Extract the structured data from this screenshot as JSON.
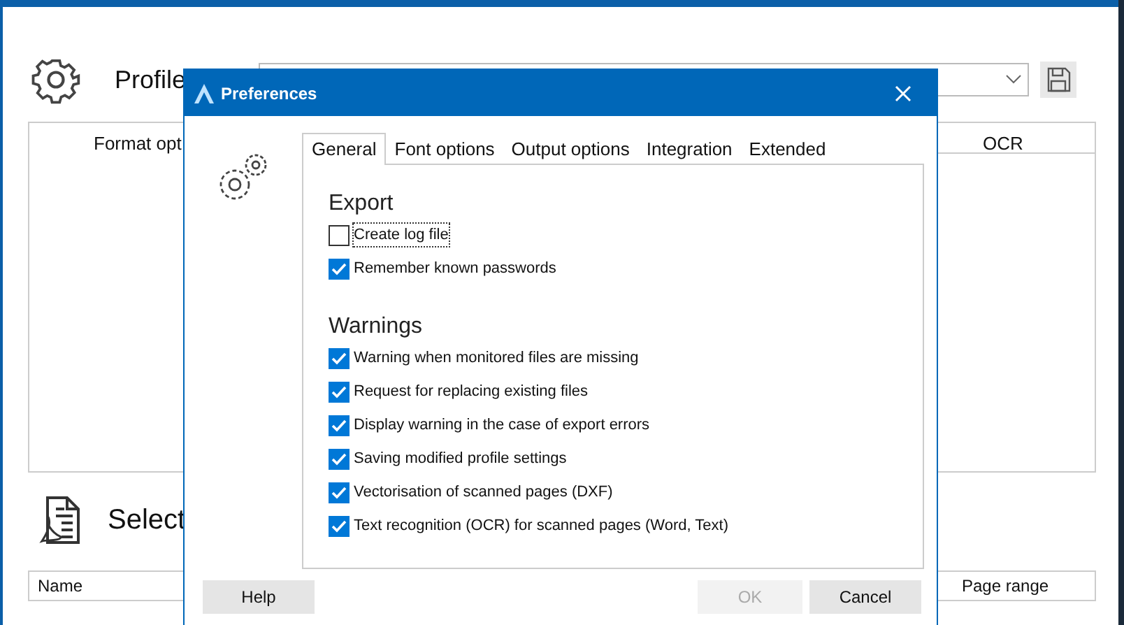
{
  "main_window": {
    "profile_title": "Profile",
    "settings_column": "Format opt",
    "ocr_column": "OCR",
    "select_title": "Select",
    "table": {
      "columns": [
        "Name",
        "Page range"
      ]
    }
  },
  "dialog": {
    "title": "Preferences",
    "tabs": [
      {
        "label": "General",
        "selected": true
      },
      {
        "label": "Font options",
        "selected": false
      },
      {
        "label": "Output options",
        "selected": false
      },
      {
        "label": "Integration",
        "selected": false
      },
      {
        "label": "Extended",
        "selected": false
      }
    ],
    "groups": [
      {
        "title": "Export",
        "options": [
          {
            "label": "Create log file",
            "checked": false,
            "focused": true
          },
          {
            "label": "Remember known passwords",
            "checked": true,
            "focused": false
          }
        ]
      },
      {
        "title": "Warnings",
        "options": [
          {
            "label": "Warning when monitored files are missing",
            "checked": true,
            "focused": false
          },
          {
            "label": "Request for replacing existing files",
            "checked": true,
            "focused": false
          },
          {
            "label": "Display warning in the case of export errors",
            "checked": true,
            "focused": false
          },
          {
            "label": "Saving modified profile settings",
            "checked": true,
            "focused": false
          },
          {
            "label": "Vectorisation of scanned pages (DXF)",
            "checked": true,
            "focused": false
          },
          {
            "label": "Text recognition (OCR) for scanned pages (Word, Text)",
            "checked": true,
            "focused": false
          }
        ]
      }
    ],
    "buttons": [
      {
        "label": "Help",
        "disabled": false
      },
      {
        "label": "OK",
        "disabled": true
      },
      {
        "label": "Cancel",
        "disabled": false
      }
    ]
  }
}
